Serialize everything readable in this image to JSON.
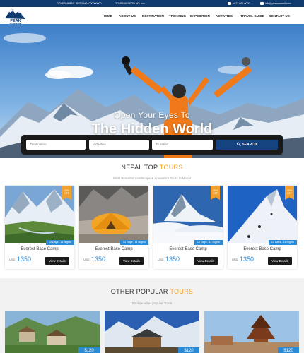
{
  "topbar": {
    "gov_reg": "GOVERNMENT REGD NO: 000000000",
    "tourism_reg": "TOURISM REGD NO: xxx",
    "phone": "+977-000-0000",
    "email": "info@peaksummit.com"
  },
  "logo": {
    "line1": "PEAK",
    "line2": "SUMMIT",
    "line3": "TREK & EXPEDITION"
  },
  "nav": {
    "items": [
      "HOME",
      "ABOUT US",
      "DESTINATION",
      "TREKKING",
      "EXPEDITION",
      "ACTIVITES",
      "TRAVEL GUIDE",
      "CONTACT US"
    ]
  },
  "hero": {
    "subtitle": "Open Your Eyes To",
    "title": "The Hidden World"
  },
  "search": {
    "destination_placeholder": "Destination",
    "activities_placeholder": "Activities",
    "duration_placeholder": "Duration",
    "button_label": "SEARCH"
  },
  "top_tours": {
    "title_main": "NEPAL TOP ",
    "title_accent": "TOURS",
    "subtitle": "Most Beautiful Landscape & Adventure Tours in Nepal",
    "cards": [
      {
        "name": "Everest Base Camp",
        "days": "12 Days - 11 Nights",
        "currency": "USD",
        "price": "1350",
        "button": "View Details",
        "ribbon": "20% OFF"
      },
      {
        "name": "Everest Base Camp",
        "days": "12 Days - 11 Nights",
        "currency": "USD",
        "price": "1350",
        "button": "View Details",
        "ribbon": ""
      },
      {
        "name": "Everest Base Camp",
        "days": "12 Days - 11 Nights",
        "currency": "USD",
        "price": "1350",
        "button": "View Details",
        "ribbon": "20% OFF"
      },
      {
        "name": "Everest Base Camp",
        "days": "12 Days - 11 Nights",
        "currency": "USD",
        "price": "1350",
        "button": "View Details",
        "ribbon": "20% OFF"
      }
    ]
  },
  "popular": {
    "title_main": "OTHER POPULAR ",
    "title_accent": "TOURS",
    "subtitle": "Explore other popular Tours",
    "cards": [
      {
        "price": "$120"
      },
      {
        "price": "$120"
      },
      {
        "price": "$120"
      }
    ]
  },
  "colors": {
    "navy": "#0f3a6e",
    "accent": "#f2a12e",
    "blue": "#2a8ad6",
    "dark": "#1a1a1a"
  }
}
